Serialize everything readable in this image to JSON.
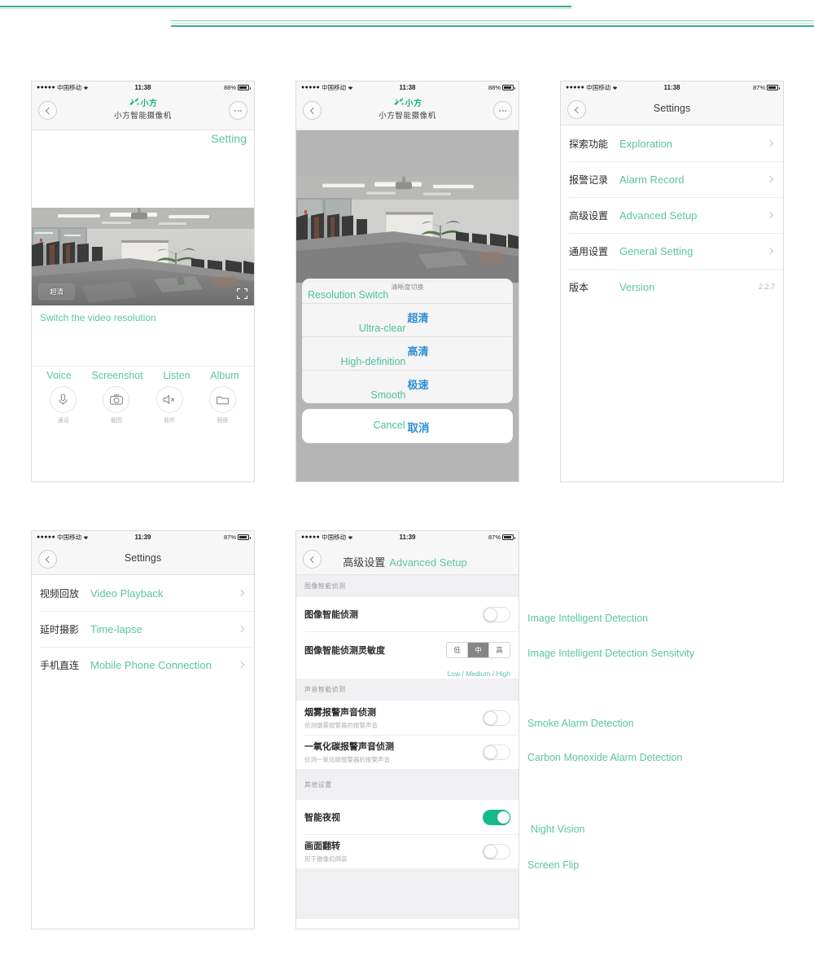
{
  "statusbar": {
    "dots": "●●●●●",
    "carrier": "中国移动",
    "time_1138": "11:38",
    "time_1139": "11:39",
    "battery_88": "88%",
    "battery_87": "87%"
  },
  "brand": {
    "cn": "小方",
    "device": "小方智能摄像机"
  },
  "phone1": {
    "setting_anno": "Setting",
    "resolution_badge": "超清",
    "switch_anno": "Switch the video resolution",
    "toolbar": [
      {
        "en": "Voice",
        "cn": "通话",
        "icon": "microphone-icon"
      },
      {
        "en": "Screenshot",
        "cn": "截图",
        "icon": "camera-icon"
      },
      {
        "en": "Listen",
        "cn": "收听",
        "icon": "speaker-mute-icon"
      },
      {
        "en": "Album",
        "cn": "相册",
        "icon": "folder-icon"
      }
    ]
  },
  "phone2": {
    "sheet_title_cn": "清晰度切换",
    "sheet_title_en": "Resolution Switch",
    "options": [
      {
        "cn": "超清",
        "en": "Ultra-clear"
      },
      {
        "cn": "高清",
        "en": "High-definition"
      },
      {
        "cn": "极速",
        "en": "Smooth"
      }
    ],
    "cancel_cn": "取消",
    "cancel_en": "Cancel"
  },
  "phone3": {
    "title": "Settings",
    "rows": [
      {
        "cn": "探索功能",
        "en": "Exploration",
        "value": "",
        "chevron": true
      },
      {
        "cn": "报警记录",
        "en": "Alarm Record",
        "value": "",
        "chevron": true
      },
      {
        "cn": "高级设置",
        "en": "Advanced Setup",
        "value": "",
        "chevron": true
      },
      {
        "cn": "通用设置",
        "en": "General Setting",
        "value": "",
        "chevron": true
      },
      {
        "cn": "版本",
        "en": "Version",
        "value": "2.2.7",
        "chevron": false
      }
    ]
  },
  "phone4": {
    "title": "Settings",
    "rows": [
      {
        "cn": "视频回放",
        "en": "Video Playback",
        "chevron": true
      },
      {
        "cn": "延时摄影",
        "en": "Time-lapse",
        "chevron": true
      },
      {
        "cn": "手机直连",
        "en": "Mobile Phone Connection",
        "chevron": true
      }
    ]
  },
  "phone5": {
    "title_cn": "高级设置",
    "title_en": "Advanced Setup",
    "section1": "图像智能侦测",
    "section2": "声音智能侦测",
    "section3": "其他设置",
    "row_image_detect": {
      "title": "图像智能侦测",
      "sub": "",
      "state": "off"
    },
    "row_sensitivity": {
      "title": "图像智能侦测灵敏度",
      "options": [
        "低",
        "中",
        "高"
      ],
      "selected_index": 1,
      "sub_en": "Low / Medium / High"
    },
    "row_smoke": {
      "title": "烟雾报警声音侦测",
      "sub": "侦测烟雾报警器的报警声音",
      "state": "off"
    },
    "row_co": {
      "title": "一氧化碳报警声音侦测",
      "sub": "侦测一氧化碳报警器的报警声音",
      "state": "off"
    },
    "row_night": {
      "title": "智能夜视",
      "sub": "",
      "state": "on"
    },
    "row_flip": {
      "title": "画面翻转",
      "sub": "用于摄像机倒装",
      "state": "off"
    }
  },
  "annotations": {
    "image_detect": "Image Intelligent Detection",
    "sensitivity": "Image Intelligent Detection Sensitvity",
    "smoke": "Smoke Alarm Detection",
    "co": "Carbon Monoxide Alarm Detection",
    "night": "Night Vision",
    "flip": "Screen Flip"
  },
  "colors": {
    "accent": "#5cc3a7",
    "brand": "#18b287",
    "toggle_on": "#17b98a",
    "blue": "#2f8fd8"
  }
}
